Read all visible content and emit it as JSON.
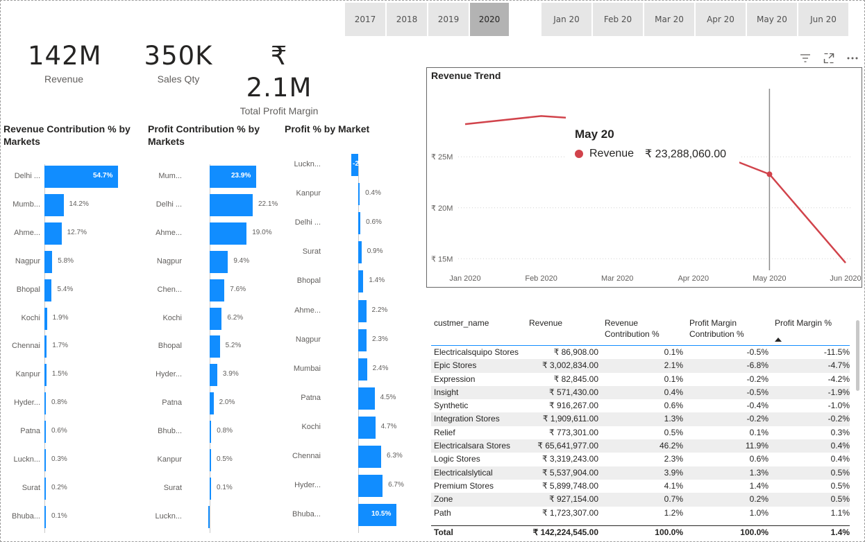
{
  "year_slicer": [
    "2017",
    "2018",
    "2019",
    "2020"
  ],
  "year_selected": "2020",
  "month_slicer": [
    "Jan 20",
    "Feb 20",
    "Mar 20",
    "Apr 20",
    "May 20",
    "Jun 20"
  ],
  "kpis": [
    {
      "value": "142M",
      "label": "Revenue"
    },
    {
      "value": "350K",
      "label": "Sales Qty"
    },
    {
      "value": "₹ 2.1M",
      "label": "Total Profit Margin"
    }
  ],
  "visual_icons": [
    "filter-icon",
    "focus-mode-icon",
    "more-options-icon"
  ],
  "chart_data": [
    {
      "type": "bar",
      "title": "Revenue Contribution % by Markets",
      "categories": [
        "Delhi ...",
        "Mumb...",
        "Ahme...",
        "Nagpur",
        "Bhopal",
        "Kochi",
        "Chennai",
        "Kanpur",
        "Hyder...",
        "Patna",
        "Luckn...",
        "Surat",
        "Bhuba..."
      ],
      "values": [
        54.7,
        14.2,
        12.7,
        5.8,
        5.4,
        1.9,
        1.7,
        1.5,
        0.8,
        0.6,
        0.3,
        0.2,
        0.1
      ],
      "labels": [
        "54.7%",
        "14.2%",
        "12.7%",
        "5.8%",
        "5.4%",
        "1.9%",
        "1.7%",
        "1.5%",
        "0.8%",
        "0.6%",
        "0.3%",
        "0.2%",
        "0.1%"
      ]
    },
    {
      "type": "bar",
      "title": "Profit Contribution % by Markets",
      "categories": [
        "Mum...",
        "Delhi ...",
        "Ahme...",
        "Nagpur",
        "Chen...",
        "Kochi",
        "Bhopal",
        "Hyder...",
        "Patna",
        "Bhub...",
        "Kanpur",
        "Surat",
        "Luckn..."
      ],
      "values": [
        23.9,
        22.1,
        19.0,
        9.4,
        7.6,
        6.2,
        5.2,
        3.9,
        2.0,
        0.8,
        0.5,
        0.1,
        -0.2
      ],
      "labels": [
        "23.9%",
        "22.1%",
        "19.0%",
        "9.4%",
        "7.6%",
        "6.2%",
        "5.2%",
        "3.9%",
        "2.0%",
        "0.8%",
        "0.5%",
        "0.1%",
        ""
      ]
    },
    {
      "type": "bar",
      "title": "Profit % by Market",
      "categories": [
        "Luckn...",
        "Kanpur",
        "Delhi ...",
        "Surat",
        "Bhopal",
        "Ahme...",
        "Nagpur",
        "Mumbai",
        "Patna",
        "Kochi",
        "Chennai",
        "Hyder...",
        "Bhuba..."
      ],
      "values": [
        -2.0,
        0.4,
        0.6,
        0.9,
        1.4,
        2.2,
        2.3,
        2.4,
        4.5,
        4.7,
        6.3,
        6.7,
        10.5
      ],
      "labels": [
        "-2",
        "0.4%",
        "0.6%",
        "0.9%",
        "1.4%",
        "2.2%",
        "2.3%",
        "2.4%",
        "4.5%",
        "4.7%",
        "6.3%",
        "6.7%",
        "10.5%"
      ]
    },
    {
      "type": "line",
      "title": "Revenue Trend",
      "x": [
        "Jan 2020",
        "Feb 2020",
        "Mar 2020",
        "Apr 2020",
        "May 2020",
        "Jun 2020"
      ],
      "series": [
        {
          "name": "Revenue",
          "values": [
            28.2,
            29.0,
            28.5,
            26.2,
            23.29,
            14.6
          ]
        }
      ],
      "yticks": [
        "₹ 15M",
        "₹ 20M",
        "₹ 25M"
      ],
      "ylim": [
        14.0,
        31.0
      ],
      "line_color": "#d1434b",
      "tooltip": {
        "title": "May 20",
        "series": "Revenue",
        "value": "₹ 23,288,060.00"
      }
    }
  ],
  "table": {
    "headers": [
      "custmer_name",
      "Revenue",
      "Revenue\nContribution %",
      "Profit Margin\nContribution %",
      "Profit Margin %"
    ],
    "rows": [
      [
        "Electricalsquipo Stores",
        "₹ 86,908.00",
        "0.1%",
        "-0.5%",
        "-11.5%"
      ],
      [
        "Epic Stores",
        "₹ 3,002,834.00",
        "2.1%",
        "-6.8%",
        "-4.7%"
      ],
      [
        "Expression",
        "₹ 82,845.00",
        "0.1%",
        "-0.2%",
        "-4.2%"
      ],
      [
        "Insight",
        "₹ 571,430.00",
        "0.4%",
        "-0.5%",
        "-1.9%"
      ],
      [
        "Synthetic",
        "₹ 916,267.00",
        "0.6%",
        "-0.4%",
        "-1.0%"
      ],
      [
        "Integration Stores",
        "₹ 1,909,611.00",
        "1.3%",
        "-0.2%",
        "-0.2%"
      ],
      [
        "Relief",
        "₹ 773,301.00",
        "0.5%",
        "0.1%",
        "0.3%"
      ],
      [
        "Electricalsara Stores",
        "₹ 65,641,977.00",
        "46.2%",
        "11.9%",
        "0.4%"
      ],
      [
        "Logic Stores",
        "₹ 3,319,243.00",
        "2.3%",
        "0.6%",
        "0.4%"
      ],
      [
        "Electricalslytical",
        "₹ 5,537,904.00",
        "3.9%",
        "1.3%",
        "0.5%"
      ],
      [
        "Premium Stores",
        "₹ 5,899,748.00",
        "4.1%",
        "1.4%",
        "0.5%"
      ],
      [
        "Zone",
        "₹ 927,154.00",
        "0.7%",
        "0.2%",
        "0.5%"
      ],
      [
        "Path",
        "₹ 1,723,307.00",
        "1.2%",
        "1.0%",
        "1.1%"
      ]
    ],
    "total": [
      "Total",
      "₹ 142,224,545.00",
      "100.0%",
      "100.0%",
      "1.4%"
    ]
  }
}
